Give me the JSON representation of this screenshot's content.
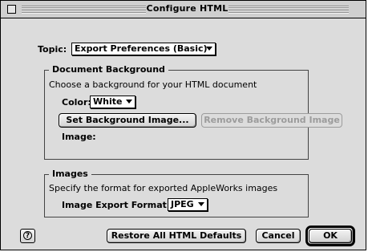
{
  "window": {
    "title": "Configure HTML"
  },
  "topic": {
    "label": "Topic:",
    "value": "Export Preferences (Basic)"
  },
  "document_background": {
    "title": "Document Background",
    "description": "Choose a background for your HTML document",
    "color_label": "Color:",
    "color_value": "White",
    "set_button": "Set Background Image...",
    "remove_button": "Remove Background Image",
    "image_label": "Image:"
  },
  "images": {
    "title": "Images",
    "description": "Specify the format for exported AppleWorks images",
    "format_label": "Image Export Format:",
    "format_value": "JPEG"
  },
  "footer": {
    "help_icon": "question-mark-icon",
    "restore_button": "Restore All HTML Defaults",
    "cancel_button": "Cancel",
    "ok_button": "OK"
  }
}
